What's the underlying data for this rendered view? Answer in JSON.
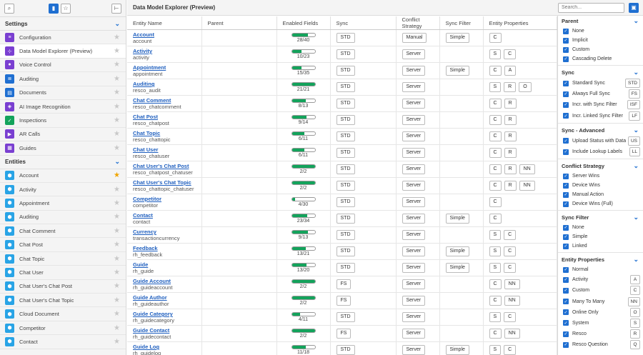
{
  "page_title": "Data Model Explorer (Preview)",
  "search": {
    "placeholder": "Search..."
  },
  "sidebar": {
    "settings_header": "Settings",
    "settings": [
      {
        "label": "Configuration",
        "icon": "sliders-icon",
        "color": "#7a3fd1",
        "glyph": "≡",
        "fav": false,
        "selected": false
      },
      {
        "label": "Data Model Explorer (Preview)",
        "icon": "data-model-icon",
        "color": "#7a3fd1",
        "glyph": "⊹",
        "fav": false,
        "selected": true
      },
      {
        "label": "Voice Control",
        "icon": "microphone-icon",
        "color": "#7a3fd1",
        "glyph": "●",
        "fav": false,
        "selected": false
      },
      {
        "label": "Auditing",
        "icon": "auditing-icon",
        "color": "#1f6fd1",
        "glyph": "≣",
        "fav": false,
        "selected": false
      },
      {
        "label": "Documents",
        "icon": "documents-icon",
        "color": "#1f6fd1",
        "glyph": "▤",
        "fav": false,
        "selected": false
      },
      {
        "label": "AI Image Recognition",
        "icon": "ai-image-icon",
        "color": "#7a3fd1",
        "glyph": "◈",
        "fav": false,
        "selected": false
      },
      {
        "label": "Inspections",
        "icon": "inspections-icon",
        "color": "#13a35b",
        "glyph": "✓",
        "fav": false,
        "selected": false
      },
      {
        "label": "AR Calls",
        "icon": "video-call-icon",
        "color": "#7a3fd1",
        "glyph": "▶",
        "fav": false,
        "selected": false
      },
      {
        "label": "Guides",
        "icon": "guides-icon",
        "color": "#7a3fd1",
        "glyph": "▦",
        "fav": false,
        "selected": false
      }
    ],
    "entities_header": "Entities",
    "entities": [
      {
        "label": "Account",
        "fav": true
      },
      {
        "label": "Activity",
        "fav": false
      },
      {
        "label": "Appointment",
        "fav": false
      },
      {
        "label": "Auditing",
        "fav": false
      },
      {
        "label": "Chat Comment",
        "fav": false
      },
      {
        "label": "Chat Post",
        "fav": false
      },
      {
        "label": "Chat Topic",
        "fav": false
      },
      {
        "label": "Chat User",
        "fav": false
      },
      {
        "label": "Chat User's Chat Post",
        "fav": false
      },
      {
        "label": "Chat User's Chat Topic",
        "fav": false
      },
      {
        "label": "Cloud Document",
        "fav": false
      },
      {
        "label": "Competitor",
        "fav": false
      },
      {
        "label": "Contact",
        "fav": false
      }
    ]
  },
  "table": {
    "columns": [
      "Entity Name",
      "Parent",
      "Enabled Fields",
      "Sync",
      "Conflict Strategy",
      "Sync Filter",
      "Entity Properties"
    ],
    "rows": [
      {
        "name": "Account",
        "logical": "account",
        "enabled": 28,
        "total": 40,
        "sync": "STD",
        "conflict": "Manual",
        "filter": "Simple",
        "props": [
          "C"
        ]
      },
      {
        "name": "Activity",
        "logical": "activity",
        "enabled": 10,
        "total": 23,
        "sync": "STD",
        "conflict": "Server",
        "filter": "",
        "props": [
          "S",
          "C"
        ]
      },
      {
        "name": "Appointment",
        "logical": "appointment",
        "enabled": 15,
        "total": 35,
        "sync": "STD",
        "conflict": "Server",
        "filter": "Simple",
        "props": [
          "C",
          "A"
        ]
      },
      {
        "name": "Auditing",
        "logical": "resco_audit",
        "enabled": 21,
        "total": 21,
        "sync": "STD",
        "conflict": "Server",
        "filter": "",
        "props": [
          "S",
          "R",
          "O"
        ]
      },
      {
        "name": "Chat Comment",
        "logical": "resco_chatcomment",
        "enabled": 8,
        "total": 13,
        "sync": "STD",
        "conflict": "Server",
        "filter": "",
        "props": [
          "C",
          "R"
        ]
      },
      {
        "name": "Chat Post",
        "logical": "resco_chatpost",
        "enabled": 9,
        "total": 14,
        "sync": "STD",
        "conflict": "Server",
        "filter": "",
        "props": [
          "C",
          "R"
        ]
      },
      {
        "name": "Chat Topic",
        "logical": "resco_chattopic",
        "enabled": 6,
        "total": 11,
        "sync": "STD",
        "conflict": "Server",
        "filter": "",
        "props": [
          "C",
          "R"
        ]
      },
      {
        "name": "Chat User",
        "logical": "resco_chatuser",
        "enabled": 6,
        "total": 11,
        "sync": "STD",
        "conflict": "Server",
        "filter": "",
        "props": [
          "C",
          "R"
        ]
      },
      {
        "name": "Chat User's Chat Post",
        "logical": "resco_chatpost_chatuser",
        "enabled": 2,
        "total": 2,
        "sync": "STD",
        "conflict": "Server",
        "filter": "",
        "props": [
          "C",
          "R",
          "NN"
        ]
      },
      {
        "name": "Chat User's Chat Topic",
        "logical": "resco_chattopic_chatuser",
        "enabled": 2,
        "total": 2,
        "sync": "STD",
        "conflict": "Server",
        "filter": "",
        "props": [
          "C",
          "R",
          "NN"
        ]
      },
      {
        "name": "Competitor",
        "logical": "competitor",
        "enabled": 4,
        "total": 30,
        "sync": "STD",
        "conflict": "Server",
        "filter": "",
        "props": [
          "C"
        ]
      },
      {
        "name": "Contact",
        "logical": "contact",
        "enabled": 23,
        "total": 34,
        "sync": "STD",
        "conflict": "Server",
        "filter": "Simple",
        "props": [
          "C"
        ]
      },
      {
        "name": "Currency",
        "logical": "transactioncurrency",
        "enabled": 9,
        "total": 13,
        "sync": "STD",
        "conflict": "Server",
        "filter": "",
        "props": [
          "S",
          "C"
        ]
      },
      {
        "name": "Feedback",
        "logical": "rh_feedback",
        "enabled": 13,
        "total": 21,
        "sync": "STD",
        "conflict": "Server",
        "filter": "Simple",
        "props": [
          "S",
          "C"
        ]
      },
      {
        "name": "Guide",
        "logical": "rh_guide",
        "enabled": 13,
        "total": 20,
        "sync": "STD",
        "conflict": "Server",
        "filter": "Simple",
        "props": [
          "S",
          "C"
        ]
      },
      {
        "name": "Guide Account",
        "logical": "rh_guideaccount",
        "enabled": 2,
        "total": 2,
        "sync": "FS",
        "conflict": "Server",
        "filter": "",
        "props": [
          "C",
          "NN"
        ]
      },
      {
        "name": "Guide Author",
        "logical": "rh_guideauthor",
        "enabled": 2,
        "total": 2,
        "sync": "FS",
        "conflict": "Server",
        "filter": "",
        "props": [
          "C",
          "NN"
        ]
      },
      {
        "name": "Guide Category",
        "logical": "rh_guidecategory",
        "enabled": 4,
        "total": 11,
        "sync": "STD",
        "conflict": "Server",
        "filter": "",
        "props": [
          "S",
          "C"
        ]
      },
      {
        "name": "Guide Contact",
        "logical": "rh_guidecontact",
        "enabled": 2,
        "total": 2,
        "sync": "FS",
        "conflict": "Server",
        "filter": "",
        "props": [
          "C",
          "NN"
        ]
      },
      {
        "name": "Guide Log",
        "logical": "rh_guidelog",
        "enabled": 11,
        "total": 18,
        "sync": "STD",
        "conflict": "Server",
        "filter": "Simple",
        "props": [
          "S",
          "C"
        ]
      }
    ]
  },
  "filters": [
    {
      "title": "Parent",
      "options": [
        {
          "label": "None",
          "code": ""
        },
        {
          "label": "Implicit",
          "code": ""
        },
        {
          "label": "Custom",
          "code": ""
        },
        {
          "label": "Cascading Delete",
          "code": ""
        }
      ]
    },
    {
      "title": "Sync",
      "options": [
        {
          "label": "Standard Sync",
          "code": "STD"
        },
        {
          "label": "Always Full Sync",
          "code": "FS"
        },
        {
          "label": "Incr. with Sync Filter",
          "code": "ISF"
        },
        {
          "label": "Incr. Linked Sync Filter",
          "code": "LF"
        }
      ]
    },
    {
      "title": "Sync - Advanced",
      "options": [
        {
          "label": "Upload Status with Data",
          "code": "US"
        },
        {
          "label": "Include Lookup Labels",
          "code": "LL"
        }
      ]
    },
    {
      "title": "Conflict Strategy",
      "options": [
        {
          "label": "Server Wins",
          "code": ""
        },
        {
          "label": "Device Wins",
          "code": ""
        },
        {
          "label": "Manual Action",
          "code": ""
        },
        {
          "label": "Device Wins (Full)",
          "code": ""
        }
      ]
    },
    {
      "title": "Sync Filter",
      "options": [
        {
          "label": "None",
          "code": ""
        },
        {
          "label": "Simple",
          "code": ""
        },
        {
          "label": "Linked",
          "code": ""
        }
      ]
    },
    {
      "title": "Entity Properties",
      "options": [
        {
          "label": "Normal",
          "code": ""
        },
        {
          "label": "Activity",
          "code": "A"
        },
        {
          "label": "Custom",
          "code": "C"
        },
        {
          "label": "Many To Many",
          "code": "NN"
        },
        {
          "label": "Online Only",
          "code": "O"
        },
        {
          "label": "System",
          "code": "S"
        },
        {
          "label": "Resco",
          "code": "R"
        },
        {
          "label": "Resco Question",
          "code": "Q"
        }
      ]
    }
  ],
  "colors": {
    "accent": "#1f6fd1",
    "progress": "#13a35b",
    "favorite": "#f0a500",
    "entity_icon": "#29a4e6"
  }
}
